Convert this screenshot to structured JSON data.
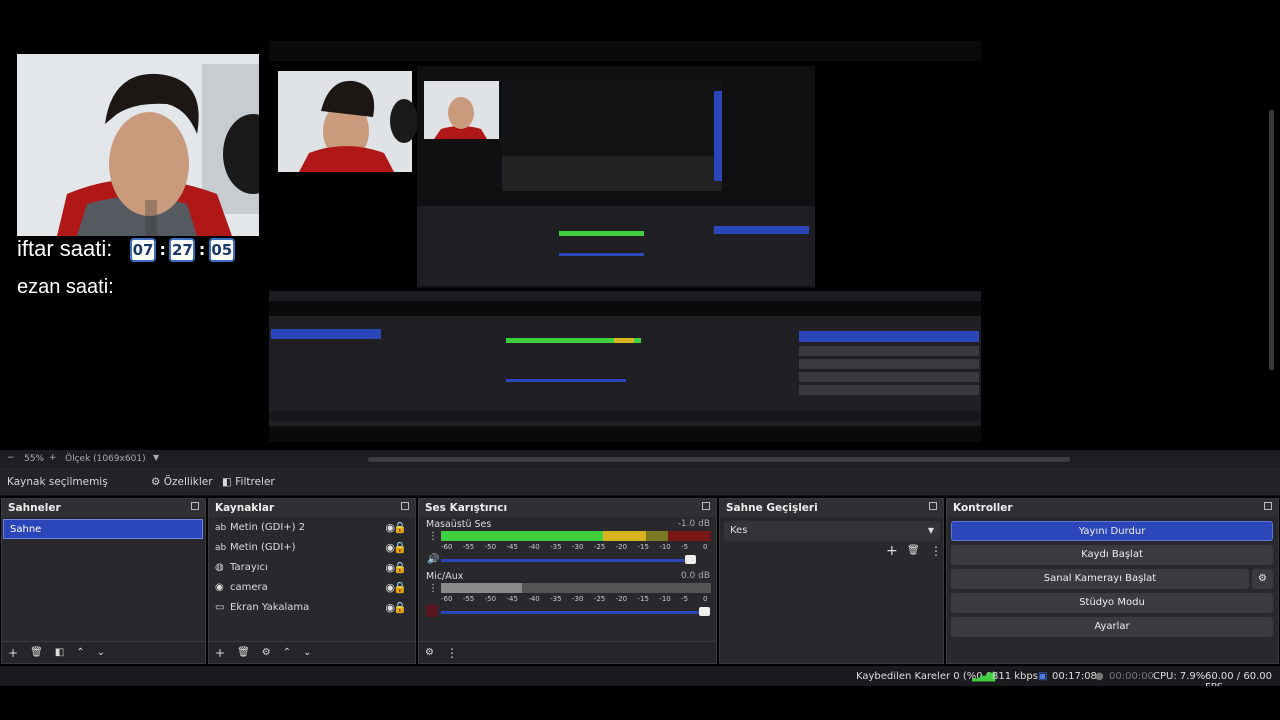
{
  "preview": {
    "iftar_label": "iftar saati:",
    "ezan_label": "ezan saati:",
    "time": [
      "07",
      "27",
      "05"
    ],
    "colon": ":"
  },
  "zoom": {
    "minus": "−",
    "value": "55%",
    "plus": "+",
    "resolution": "Ölçek (1069x601)"
  },
  "source_bar": {
    "no_source": "Kaynak seçilmemiş",
    "properties": "Özellikler",
    "filters": "Filtreler"
  },
  "scenes": {
    "title": "Sahneler",
    "items": [
      "Sahne"
    ]
  },
  "sources": {
    "title": "Kaynaklar",
    "items": [
      {
        "icon": "text-icon",
        "glyph": "ab",
        "label": "Metin (GDI+) 2"
      },
      {
        "icon": "text-icon",
        "glyph": "ab",
        "label": "Metin (GDI+)"
      },
      {
        "icon": "browser-icon",
        "glyph": "◍",
        "label": "Tarayıcı"
      },
      {
        "icon": "camera-icon",
        "glyph": "◉",
        "label": "camera"
      },
      {
        "icon": "monitor-icon",
        "glyph": "▭",
        "label": "Ekran Yakalama"
      }
    ]
  },
  "mixer": {
    "title": "Ses Karıştırıcı",
    "channels": [
      {
        "name": "Masaüstü Ses",
        "db": "-1.0 dB",
        "level": 0.82
      },
      {
        "name": "Mic/Aux",
        "db": "0.0 dB",
        "level": 0.0
      }
    ],
    "ticks": [
      "-60",
      "-55",
      "-50",
      "-45",
      "-40",
      "-35",
      "-30",
      "-25",
      "-20",
      "-15",
      "-10",
      "-5",
      "0"
    ]
  },
  "transitions": {
    "title": "Sahne Geçişleri",
    "selected": "Kes"
  },
  "controls": {
    "title": "Kontroller",
    "stop_stream": "Yayını Durdur",
    "start_record": "Kaydı Başlat",
    "virtual_cam": "Sanal Kamerayı Başlat",
    "studio_mode": "Stüdyo Modu",
    "settings": "Ayarlar"
  },
  "status": {
    "dropped": "Kaybedilen Kareler 0 (%0.0)",
    "bitrate": "811 kbps",
    "stream_time": "00:17:08",
    "record_time": "00:00:00",
    "cpu": "CPU: 7.9%",
    "fps": "60.00 / 60.00 FPS"
  },
  "colors": {
    "accent": "#2b46b8",
    "meter_green": "#3fcf3f",
    "meter_yellow": "#d8b51e",
    "meter_red": "#b81e1e"
  }
}
